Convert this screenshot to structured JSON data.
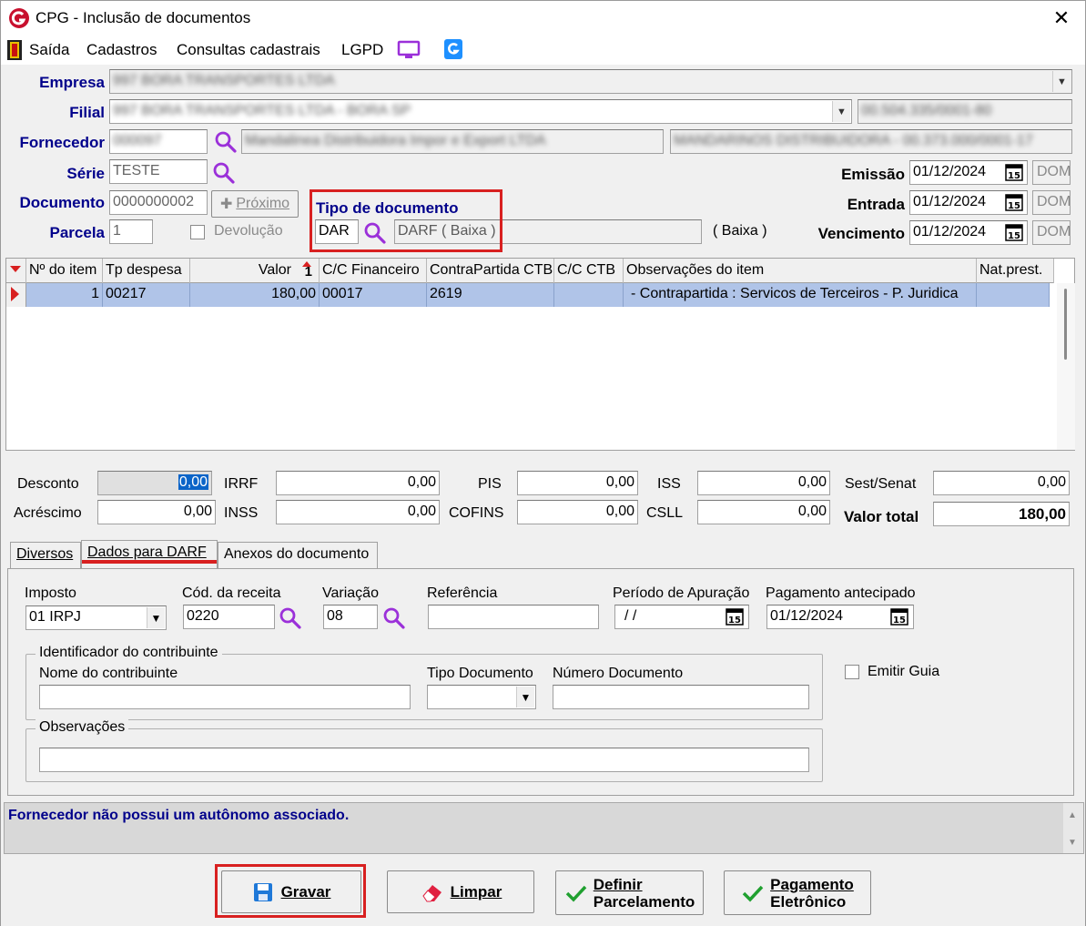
{
  "window": {
    "title": "CPG - Inclusão de documentos",
    "close": "✕"
  },
  "menu": {
    "saida": "Saída",
    "cadastros": "Cadastros",
    "consultas": "Consultas cadastrais",
    "lgpd": "LGPD"
  },
  "header": {
    "empresa_label": "Empresa",
    "empresa_value": "997 BORA TRANSPORTES LTDA",
    "filial_label": "Filial",
    "filial_value": "997 BORA TRANSPORTES LTDA - BORA SP",
    "filial_cnpj": "00.504.335/0001-80",
    "fornecedor_label": "Fornecedor",
    "fornecedor_code": "000097",
    "fornecedor_name": "Mandalinea Distribuidora Impor e Export LTDA",
    "fornecedor_addr": "MANDARINOS DISTRIBUIDORA - 00.373.000/0001-17",
    "serie_label": "Série",
    "serie_value": "TESTE",
    "documento_label": "Documento",
    "documento_value": "0000000002",
    "proximo_label": "Próximo",
    "parcela_label": "Parcela",
    "parcela_value": "1",
    "devolucao_label": "Devolução",
    "tipo_doc_label": "Tipo de documento",
    "tipo_doc_code": "DAR",
    "tipo_doc_desc": "DARF ( Baixa )",
    "tipo_doc_extra": "( Baixa )",
    "emissao_label": "Emissão",
    "emissao_value": "01/12/2024",
    "emissao_dow": "DOM",
    "entrada_label": "Entrada",
    "entrada_value": "01/12/2024",
    "entrada_dow": "DOM",
    "vencimento_label": "Vencimento",
    "vencimento_value": "01/12/2024",
    "vencimento_dow": "DOM"
  },
  "grid": {
    "columns": [
      "Nº do item",
      "Tp despesa",
      "Valor",
      "C/C Financeiro",
      "ContraPartida CTB",
      "C/C CTB",
      "Observações do item",
      "Nat.prest."
    ],
    "sort_indicator": "1",
    "rows": [
      {
        "item": "1",
        "tp": "00217",
        "valor": "180,00",
        "cc_fin": "00017",
        "contra": "2619",
        "cc_ctb": "",
        "obs": "- Contrapartida : Servicos de Terceiros - P. Juridica",
        "nat": ""
      }
    ]
  },
  "totals": {
    "desconto_label": "Desconto",
    "desconto": "0,00",
    "acrescimo_label": "Acréscimo",
    "acrescimo": "0,00",
    "irrf_label": "IRRF",
    "irrf": "0,00",
    "inss_label": "INSS",
    "inss": "0,00",
    "pis_label": "PIS",
    "pis": "0,00",
    "cofins_label": "COFINS",
    "cofins": "0,00",
    "iss_label": "ISS",
    "iss": "0,00",
    "csll_label": "CSLL",
    "csll": "0,00",
    "sest_label": "Sest/Senat",
    "sest": "0,00",
    "total_label": "Valor total",
    "total": "180,00"
  },
  "tabs": [
    "Diversos",
    "Dados para DARF",
    "Anexos do documento"
  ],
  "darf": {
    "imposto_label": "Imposto",
    "imposto_value": "01 IRPJ",
    "cod_receita_label": "Cód. da receita",
    "cod_receita_value": "0220",
    "variacao_label": "Variação",
    "variacao_value": "08",
    "referencia_label": "Referência",
    "referencia_value": "",
    "periodo_label": "Período de Apuração",
    "periodo_value": " / /",
    "pagamento_label": "Pagamento antecipado",
    "pagamento_value": "01/12/2024",
    "identificador_title": "Identificador do contribuinte",
    "nome_label": "Nome do contribuinte",
    "tipo_doc_label": "Tipo Documento",
    "numero_doc_label": "Número Documento",
    "observacoes_title": "Observações",
    "emitir_guia_label": "Emitir Guia"
  },
  "status": {
    "message": "Fornecedor não possui um autônomo associado."
  },
  "buttons": {
    "gravar": "Gravar",
    "limpar": "Limpar",
    "definir_1": "Definir",
    "definir_2": "Parcelamento",
    "pagamento_1": "Pagamento",
    "pagamento_2": "Eletrônico"
  },
  "colors": {
    "accent_red": "#d82020",
    "label_blue": "#00008b",
    "selected_row": "#b0c4e8",
    "icon_purple": "#9b30d9"
  }
}
